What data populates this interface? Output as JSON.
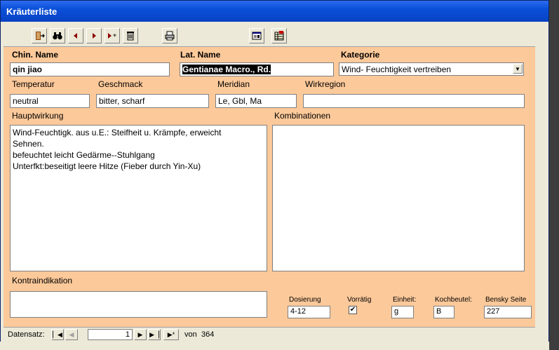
{
  "window": {
    "title": "Kräuterliste"
  },
  "toolbar": {
    "buttons": [
      "exit-door-icon",
      "binoculars-icon",
      "previous-record-icon",
      "next-record-icon",
      "new-record-icon",
      "trash-icon",
      "printer-icon",
      "form-view-icon",
      "table-view-icon"
    ]
  },
  "fields": {
    "chin_name": {
      "label": "Chin. Name",
      "value": "qin jiao"
    },
    "lat_name": {
      "label": "Lat. Name",
      "value": "Gentianae Macro., Rd."
    },
    "kategorie": {
      "label": "Kategorie",
      "value": "Wind- Feuchtigkeit vertreiben"
    },
    "temperatur": {
      "label": "Temperatur",
      "value": "neutral"
    },
    "geschmack": {
      "label": "Geschmack",
      "value": "bitter, scharf"
    },
    "meridian": {
      "label": "Meridian",
      "value": "Le, Gbl, Ma"
    },
    "wirkregion": {
      "label": "Wirkregion",
      "value": ""
    },
    "hauptwirkung": {
      "label": "Hauptwirkung",
      "value": "Wind-Feuchtigk. aus u.E.: Steifheit u. Krämpfe, erweicht\nSehnen.\nbefeuchtet leicht Gedärme--Stuhlgang\nUnterfkt:beseitigt leere Hitze (Fieber durch Yin-Xu)"
    },
    "kombinationen": {
      "label": "Kombinationen",
      "value": ""
    },
    "kontraindikation": {
      "label": "Kontraindikation",
      "value": ""
    },
    "dosierung": {
      "label": "Dosierung",
      "value": "4-12"
    },
    "vorraetig": {
      "label": "Vorrätig",
      "checked": "✔"
    },
    "einheit": {
      "label": "Einheit:",
      "value": "g"
    },
    "kochbeutel": {
      "label": "Kochbeutel:",
      "value": "B"
    },
    "bensky": {
      "label": "Bensky Seite",
      "value": "227"
    }
  },
  "navigation": {
    "label": "Datensatz:",
    "current": "1",
    "of_label": "von",
    "total": "364"
  },
  "colors": {
    "form_bg": "#fcc99a",
    "titlebar": "#0a4fd8"
  }
}
